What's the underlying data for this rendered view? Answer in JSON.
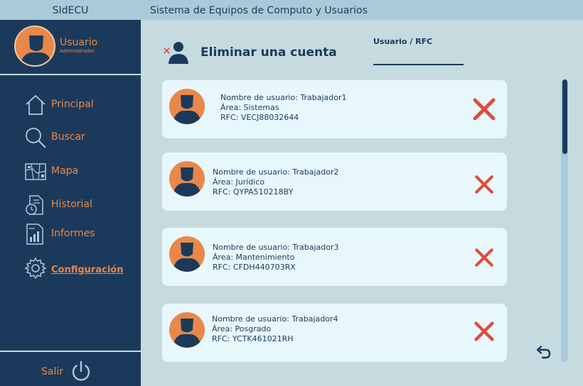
{
  "header": {
    "app_name": "SIdECU",
    "title": "Sistema de Equipos de Computo y Usuarios"
  },
  "profile": {
    "name": "Usuario",
    "role": "Administrador"
  },
  "sidebar": {
    "items": [
      {
        "label": "Principal",
        "icon": "home-icon"
      },
      {
        "label": "Buscar",
        "icon": "search-icon"
      },
      {
        "label": "Mapa",
        "icon": "map-icon"
      },
      {
        "label": "Historial",
        "icon": "history-icon"
      },
      {
        "label": "Informes",
        "icon": "reports-icon"
      },
      {
        "label": "Configuración",
        "icon": "gear-icon",
        "active": true
      }
    ],
    "logout_label": "Salir"
  },
  "page": {
    "title": "Eliminar una cuenta",
    "search_label": "Usuario / RFC",
    "search_value": ""
  },
  "accounts": [
    {
      "username": "Nombre de usuario: Trabajador1",
      "area": "Área: Sistemas",
      "rfc": "RFC: VECJ88032644"
    },
    {
      "username": "Nombre de usuario: Trabajador2",
      "area": "Área: Jurídico",
      "rfc": "RFC: QYPA510218BY"
    },
    {
      "username": "Nombre de usuario: Trabajador3",
      "area": "Área: Mantenimiento",
      "rfc": "RFC: CFDH440703RX"
    },
    {
      "username": "Nombre de usuario: Trabajador4",
      "area": "Área: Posgrado",
      "rfc": "RFC: YCTK461021RH"
    }
  ],
  "colors": {
    "navy": "#1b3a5b",
    "accent_orange": "#e8884a",
    "delete_red": "#e04b3d",
    "card_bg": "#e8f7fc",
    "content_bg": "#c5dbe0",
    "topbar_bg": "#a9cbd9"
  }
}
